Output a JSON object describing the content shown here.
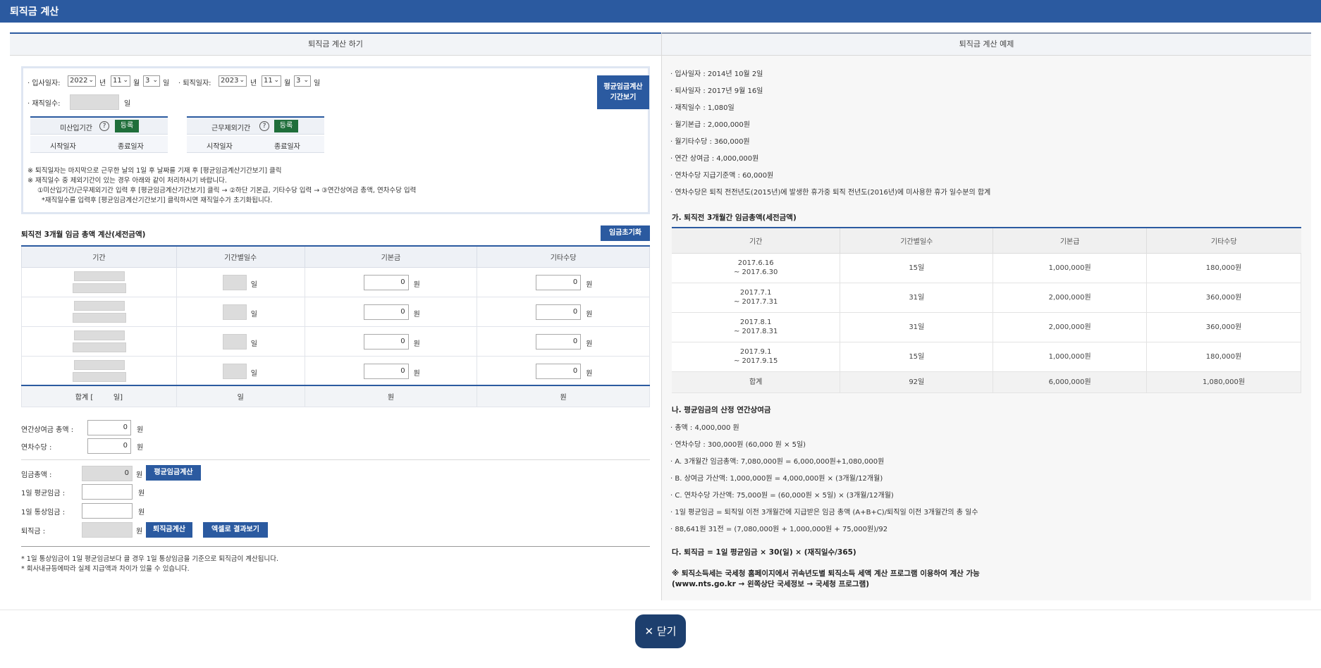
{
  "window": {
    "title": "퇴직금 계산"
  },
  "left": {
    "header": "퇴직금 계산 하기",
    "form": {
      "join_label": "입사일자:",
      "join_year": "2022",
      "join_month": "11",
      "join_day": "3",
      "leave_label": "퇴직일자:",
      "leave_year": "2023",
      "leave_month": "11",
      "leave_day": "3",
      "unit_year": "년",
      "unit_month": "월",
      "unit_day": "일",
      "tenure_label": "재직일수:",
      "tenure_unit": "일",
      "avg_period_button": "평균임금계산\n기간보기",
      "exclude_a": {
        "title": "미산입기간",
        "help": "?",
        "register": "등록",
        "start": "시작일자",
        "end": "종료일자"
      },
      "exclude_b": {
        "title": "근무제외기간",
        "help": "?",
        "register": "등록",
        "start": "시작일자",
        "end": "종료일자"
      },
      "notes": [
        "※ 퇴직일자는 마지막으로 근무한 날의 1일 후 날짜를 기재 후 [평균임금계산기간보기] 클릭",
        "※ 재직일수 중 제외기간이 있는 경우 아래와 같이 처리하시기 바랍니다.",
        "①미산입기간/근무제외기간 입력 후 [평균임금계산기간보기] 클릭 → ②하단 기본급, 기타수당 입력 → ③연간상여금 총액, 연차수당 입력",
        "*재직일수를 입력후 [평균임금계산기간보기] 클릭하시면 재직일수가 초기화됩니다."
      ]
    },
    "wage_section": {
      "title": "퇴직전 3개월 임금 총액 계산(세전금액)",
      "reset_button": "임금초기화",
      "columns": [
        "기간",
        "기간별일수",
        "기본금",
        "기타수당"
      ],
      "rows": [
        {
          "days_unit": "일",
          "base": "0",
          "base_unit": "원",
          "other": "0",
          "other_unit": "원"
        },
        {
          "days_unit": "일",
          "base": "0",
          "base_unit": "원",
          "other": "0",
          "other_unit": "원"
        },
        {
          "days_unit": "일",
          "base": "0",
          "base_unit": "원",
          "other": "0",
          "other_unit": "원"
        },
        {
          "days_unit": "일",
          "base": "0",
          "base_unit": "원",
          "other": "0",
          "other_unit": "원"
        }
      ],
      "total": {
        "label": "합계 [",
        "label_end": "일]",
        "days": "일",
        "base": "원",
        "other": "원"
      }
    },
    "bonus": {
      "label": "연간상여금 총액 :",
      "value": "0",
      "unit": "원"
    },
    "leave_pay": {
      "label": "연차수당 :",
      "value": "0",
      "unit": "원"
    },
    "results": {
      "wage_total_label": "임금총액 :",
      "wage_total_value": "0",
      "wage_total_unit": "원",
      "avg_calc_button": "평균임금계산",
      "daily_avg_label": "1일 평균임금 :",
      "daily_avg_unit": "원",
      "daily_ordinary_label": "1일 통상임금 :",
      "daily_ordinary_unit": "원",
      "severance_label": "퇴직금 :",
      "severance_unit": "원",
      "severance_button": "퇴직금계산",
      "excel_button": "엑셀로 결과보기"
    },
    "footnotes": [
      "* 1일 통상임금이 1일 평균임금보다 클 경우 1일 통상임금을 기준으로 퇴직금이 계산됩니다.",
      "* 회사내규등에따라 실제 지급액과 차이가 있을 수 있습니다."
    ]
  },
  "right": {
    "header": "퇴직금 계산 예제",
    "info": [
      "· 입사일자 : 2014년 10월 2일",
      "· 퇴사일자 : 2017년 9월 16일",
      "· 재직일수 : 1,080일",
      "· 월기본급 : 2,000,000원",
      "· 월기타수당 : 360,000원",
      "· 연간 상여금 : 4,000,000원",
      "· 연차수당 지급기준액 : 60,000원",
      "· 연차수당은 퇴직 전전년도(2015년)에 발생한 휴가중 퇴직 전년도(2016년)에 미사용한 휴가 일수분의 합계"
    ],
    "section_a": "가. 퇴직전 3개월간 임금총액(세전금액)",
    "table": {
      "columns": [
        "기간",
        "기간별일수",
        "기본급",
        "기타수당"
      ],
      "rows": [
        {
          "period1": "2017.6.16",
          "period2": "~ 2017.6.30",
          "days": "15일",
          "base": "1,000,000원",
          "other": "180,000원"
        },
        {
          "period1": "2017.7.1",
          "period2": "~ 2017.7.31",
          "days": "31일",
          "base": "2,000,000원",
          "other": "360,000원"
        },
        {
          "period1": "2017.8.1",
          "period2": "~ 2017.8.31",
          "days": "31일",
          "base": "2,000,000원",
          "other": "360,000원"
        },
        {
          "period1": "2017.9.1",
          "period2": "~ 2017.9.15",
          "days": "15일",
          "base": "1,000,000원",
          "other": "180,000원"
        }
      ],
      "total": {
        "label": "합계",
        "days": "92일",
        "base": "6,000,000원",
        "other": "1,080,000원"
      }
    },
    "section_b": "나. 평균임금의 산정 연간상여금",
    "calc": [
      "· 총액 : 4,000,000 원",
      "· 연차수당 : 300,000원 (60,000 원 × 5일)",
      "· A. 3개월간 임금총액: 7,080,000원 = 6,000,000원+1,080,000원",
      "· B. 상여금 가산액: 1,000,000원 = 4,000,000원 × (3개월/12개월)",
      "· C. 연차수당 가산액: 75,000원 = (60,000원 × 5일) × (3개월/12개월)",
      "· 1일 평균임금 = 퇴직일 이전 3개월간에 지급받은 임금 총액 (A+B+C)/퇴직일 이전 3개월간의 총 일수",
      "· 88,641원 31전 = (7,080,000원 + 1,000,000원 + 75,000원)/92"
    ],
    "section_c": "다. 퇴직금 = 1일 평균임금 × 30(일) × (재직일수/365)",
    "tax_note1": "※ 퇴직소득세는 국세청 홈페이지에서 귀속년도별 퇴직소득 세액 계산 프로그램 이용하여 계산 가능",
    "tax_note2": "(www.nts.go.kr → 왼쪽상단 국세정보 → 국세청 프로그램)"
  },
  "footer": {
    "close_icon": "close-icon",
    "close_label": "닫기"
  }
}
